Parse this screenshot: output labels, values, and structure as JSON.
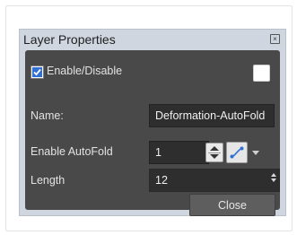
{
  "window": {
    "title": "Layer Properties"
  },
  "enable": {
    "label": "Enable/Disable",
    "checked": true
  },
  "name": {
    "label": "Name:",
    "value": "Deformation-AutoFold"
  },
  "autofold": {
    "label": "Enable AutoFold",
    "value": "1"
  },
  "length": {
    "label": "Length",
    "value": "12"
  },
  "buttons": {
    "close_label": "Close"
  },
  "icons": {
    "title_close": "close-icon",
    "checkbox": "checkbox-checked-icon",
    "color_swatch": "color-swatch-icon",
    "stepper": "spinner-icon",
    "function_curve": "function-curve-icon",
    "dropdown": "chevron-down-icon",
    "length_spinner": "spinner-icon"
  },
  "colors": {
    "panel_bg": "#494949",
    "window_bg": "#cfd6df",
    "field_bg": "#2e2e2e",
    "accent_blue": "#2f6fd6"
  }
}
